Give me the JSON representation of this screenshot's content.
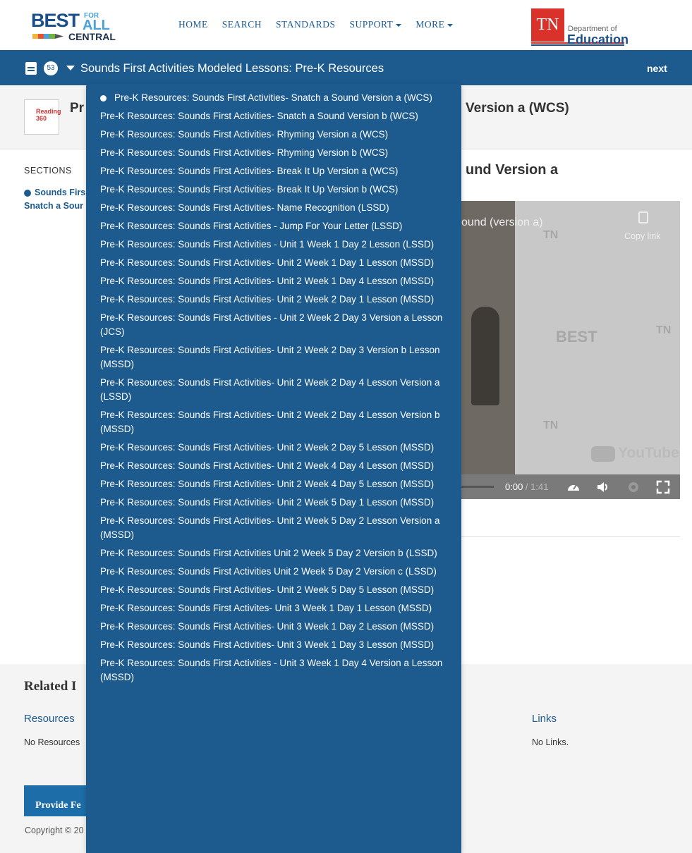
{
  "header": {
    "logo": {
      "best": "BEST",
      "for": "FOR",
      "all": "ALL",
      "central": "CENTRAL"
    },
    "nav": [
      {
        "label": "HOME"
      },
      {
        "label": "SEARCH"
      },
      {
        "label": "STANDARDS"
      },
      {
        "label": "SUPPORT",
        "dropdown": true
      },
      {
        "label": "MORE",
        "dropdown": true
      }
    ],
    "tn_logo": {
      "abbr": "TN",
      "dept": "Department of",
      "edu": "Education"
    }
  },
  "toolbar": {
    "count": "53",
    "title": "Sounds First Activities Modeled Lessons: Pre-K Resources",
    "next_label": "next"
  },
  "page": {
    "title_pre": "Pr",
    "title_post": "Version a (WCS)",
    "thumb_text": "Reading 360",
    "sections_label": "SECTIONS",
    "section_link_line1": "Sounds Firs",
    "section_link_line2": "Snatch a Sour",
    "content_heading": "und Version a"
  },
  "video": {
    "title_fragment": "ound (version a)",
    "copy_label": "Copy link",
    "time_current": "0:00",
    "time_separator": " / ",
    "time_duration": "1:41",
    "youtube_label": "YouTube"
  },
  "related": {
    "heading": "Related I",
    "resources_heading": "Resources",
    "resources_empty": "No Resources",
    "links_heading": "Links",
    "links_empty": "No Links.",
    "feedback_label": "Provide Fe",
    "copyright": "Copyright © 20"
  },
  "dropdown": {
    "items": [
      {
        "label": "Pre-K Resources: Sounds First Activities- Snatch a Sound Version a (WCS)",
        "current": true
      },
      {
        "label": "Pre-K Resources: Sounds First Activities- Snatch a Sound Version b (WCS)"
      },
      {
        "label": "Pre-K Resources: Sounds First Activities- Rhyming Version a (WCS)"
      },
      {
        "label": "Pre-K Resources: Sounds First Activities- Rhyming Version b (WCS)"
      },
      {
        "label": "Pre-K Resources: Sounds First Activities- Break It Up Version a (WCS)"
      },
      {
        "label": "Pre-K Resources: Sounds First Activities- Break It Up Version b (WCS)"
      },
      {
        "label": "Pre-K Resources: Sounds First Activities- Name Recognition (LSSD)"
      },
      {
        "label": "Pre-K Resources: Sounds First Activities - Jump For Your Letter (LSSD)"
      },
      {
        "label": "Pre-K Resources: Sounds First Activities - Unit 1 Week 1 Day 2 Lesson (LSSD)"
      },
      {
        "label": "Pre-K Resources: Sounds First Activities- Unit 2 Week 1 Day 1 Lesson (MSSD)"
      },
      {
        "label": "Pre-K Resources: Sounds First Activities- Unit 2 Week 1 Day 4 Lesson (MSSD)"
      },
      {
        "label": "Pre-K Resources: Sounds First Activities- Unit 2 Week 2 Day 1 Lesson (MSSD)"
      },
      {
        "label": "Pre-K Resources: Sounds First Activities - Unit 2 Week 2 Day 3 Version a Lesson (JCS)"
      },
      {
        "label": "Pre-K Resources: Sounds First Activities- Unit 2 Week 2 Day 3 Version b Lesson (MSSD)"
      },
      {
        "label": "Pre-K Resources: Sounds First Activities- Unit 2 Week 2 Day 4 Lesson Version a (LSSD)"
      },
      {
        "label": "Pre-K Resources: Sounds First Activities- Unit 2 Week 2 Day 4 Lesson Version b (MSSD)"
      },
      {
        "label": "Pre-K Resources: Sounds First Activities- Unit 2 Week 2 Day 5 Lesson (MSSD)"
      },
      {
        "label": "Pre-K Resources: Sounds First Activities- Unit 2 Week 4 Day 4 Lesson (MSSD)"
      },
      {
        "label": "Pre-K Resources: Sounds First Activities- Unit 2 Week 4 Day 5 Lesson (MSSD)"
      },
      {
        "label": "Pre-K Resources: Sounds First Activities- Unit 2 Week 5 Day 1 Lesson (MSSD)"
      },
      {
        "label": "Pre-K Resources: Sounds First Activities- Unit 2 Week 5 Day 2 Lesson Version a (MSSD)"
      },
      {
        "label": "Pre-K Resources: Sounds First Activities Unit 2 Week 5 Day 2 Version b (LSSD)"
      },
      {
        "label": "Pre-K Resources: Sounds First Activities Unit 2 Week 5 Day 2 Version c (LSSD)"
      },
      {
        "label": "Pre-K Resources: Sounds First Activities- Unit 2 Week 5 Day 5 Lesson (MSSD)"
      },
      {
        "label": "Pre-K Resources: Sounds First Activites- Unit 3 Week 1 Day 1 Lesson (MSSD)"
      },
      {
        "label": "Pre-K Resources: Sounds First Activities- Unit 3 Week 1 Day 2 Lesson (MSSD)"
      },
      {
        "label": "Pre-K Resources: Sounds First Activities- Unit 3 Week 1 Day 3 Lesson (MSSD)"
      },
      {
        "label": "Pre-K Resources: Sounds First Activities - Unit 3 Week 1 Day 4 Version a Lesson (MSSD)"
      }
    ]
  },
  "colors": {
    "brand_blue": "#1d5a8e",
    "tn_red": "#d9322a",
    "page_gray": "#f4f4f4"
  }
}
